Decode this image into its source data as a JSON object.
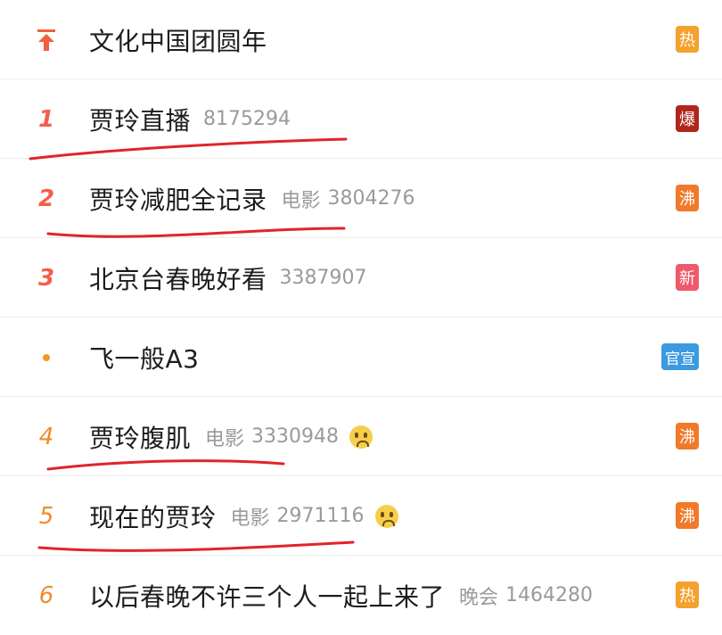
{
  "items": [
    {
      "rank": "",
      "rank_type": "pin",
      "title": "文化中国团圆年",
      "category": "",
      "count": "",
      "emoji": false,
      "badge": "热",
      "badge_color": "#f4a12d"
    },
    {
      "rank": "1",
      "rank_type": "num",
      "title": "贾玲直播",
      "category": "",
      "count": "8175294",
      "emoji": false,
      "badge": "爆",
      "badge_color": "#b0261c"
    },
    {
      "rank": "2",
      "rank_type": "num",
      "title": "贾玲减肥全记录",
      "category": "电影",
      "count": "3804276",
      "emoji": false,
      "badge": "沸",
      "badge_color": "#f07a2a"
    },
    {
      "rank": "3",
      "rank_type": "num",
      "title": "北京台春晚好看",
      "category": "",
      "count": "3387907",
      "emoji": false,
      "badge": "新",
      "badge_color": "#ee5a6a"
    },
    {
      "rank": "",
      "rank_type": "dot",
      "title": "飞一般A3",
      "category": "",
      "count": "",
      "emoji": false,
      "badge": "官宣",
      "badge_color": "#3b9ae0"
    },
    {
      "rank": "4",
      "rank_type": "num",
      "title": "贾玲腹肌",
      "category": "电影",
      "count": "3330948",
      "emoji": true,
      "emoji_name": "crying-face",
      "badge": "沸",
      "badge_color": "#f07a2a"
    },
    {
      "rank": "5",
      "rank_type": "num",
      "title": "现在的贾玲",
      "category": "电影",
      "count": "2971116",
      "emoji": true,
      "emoji_name": "crying-face",
      "badge": "沸",
      "badge_color": "#f07a2a"
    },
    {
      "rank": "6",
      "rank_type": "num",
      "title": "以后春晚不许三个人一起上来了",
      "category": "晚会",
      "count": "1464280",
      "emoji": false,
      "badge": "热",
      "badge_color": "#f4a12d"
    }
  ],
  "annotation_color": "#e0242b"
}
